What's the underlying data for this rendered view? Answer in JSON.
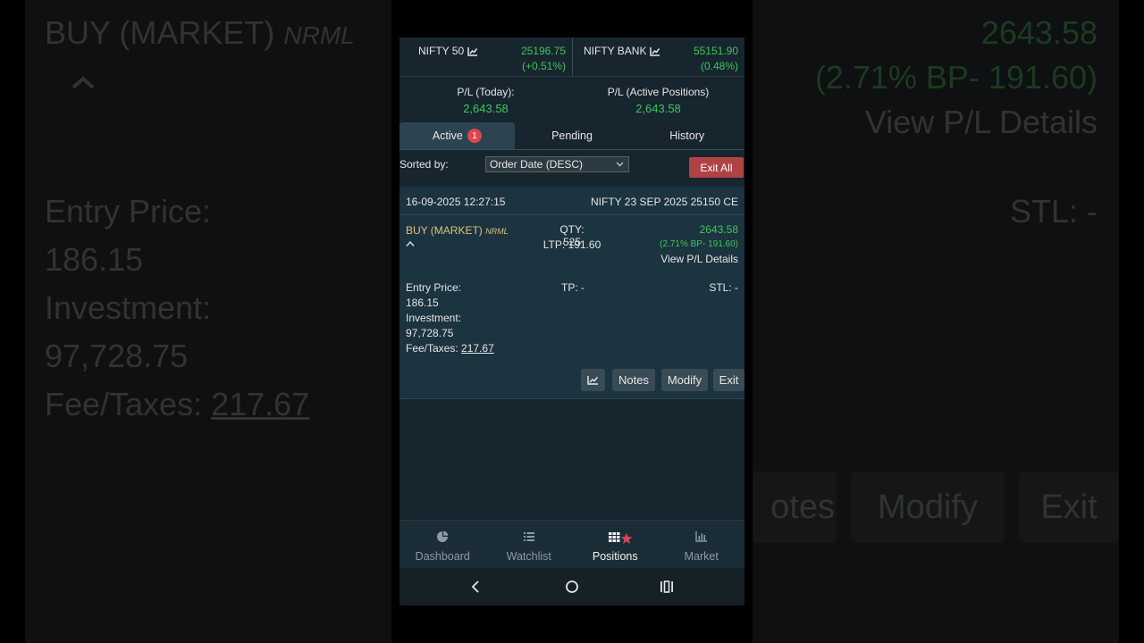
{
  "background": {
    "left": {
      "side_text": "BUY (MARKET)",
      "product_text": "NRML",
      "entry_label": "Entry Price:",
      "entry_value": "186.15",
      "investment_label": "Investment:",
      "investment_value": "97,728.75",
      "fee_label": "Fee/Taxes:",
      "fee_value": "217.67"
    },
    "right": {
      "pl_value": "2643.58",
      "bp_text": "(2.71% BP- 191.60)",
      "view_pl": "View P/L Details",
      "stl_text": "STL: -",
      "notes_partial": "otes",
      "modify": "Modify",
      "exit": "Exit"
    }
  },
  "indices": [
    {
      "name": "NIFTY 50",
      "value": "25196.75",
      "change": "(+0.51%)",
      "icon": "chart-icon"
    },
    {
      "name": "NIFTY BANK",
      "value": "55151.90",
      "change": "(0.48%)",
      "icon": "chart-icon"
    }
  ],
  "pl": {
    "today_label": "P/L (Today):",
    "today_value": "2,643.58",
    "active_label": "P/L (Active Positions)",
    "active_value": "2,643.58"
  },
  "tabs": [
    {
      "label": "Active",
      "badge": "1"
    },
    {
      "label": "Pending"
    },
    {
      "label": "History"
    }
  ],
  "sort": {
    "label": "Sorted by:",
    "selected": "Order Date (DESC)"
  },
  "exit_all_label": "Exit All",
  "position": {
    "date": "16-09-2025 12:27:15",
    "symbol": "NIFTY 23 SEP 2025 25150 CE",
    "side": "BUY (MARKET)",
    "product": "NRML",
    "qty": "QTY: 525",
    "ltp": "LTP: 191.60",
    "pl": "2643.58",
    "bp": "(2.71% BP- 191.60)",
    "view_pl": "View P/L Details",
    "entry_label": "Entry Price:",
    "entry_value": "186.15",
    "investment_label": "Investment:",
    "investment_value": "97,728.75",
    "fee_label": "Fee/Taxes:",
    "fee_value": "217.67",
    "tp": "TP: -",
    "stl": "STL: -",
    "buttons": {
      "notes": "Notes",
      "modify": "Modify",
      "exit": "Exit"
    }
  },
  "nav": [
    {
      "label": "Dashboard",
      "icon": "pie-chart-icon"
    },
    {
      "label": "Watchlist",
      "icon": "list-icon"
    },
    {
      "label": "Positions",
      "icon": "grid-icon",
      "active": true
    },
    {
      "label": "Market",
      "icon": "bar-chart-icon"
    }
  ],
  "colors": {
    "positive": "#3fc45a",
    "accent_buy": "#e0c07a",
    "danger": "#b04245",
    "badge": "#e04451",
    "panel": "#17262e"
  }
}
